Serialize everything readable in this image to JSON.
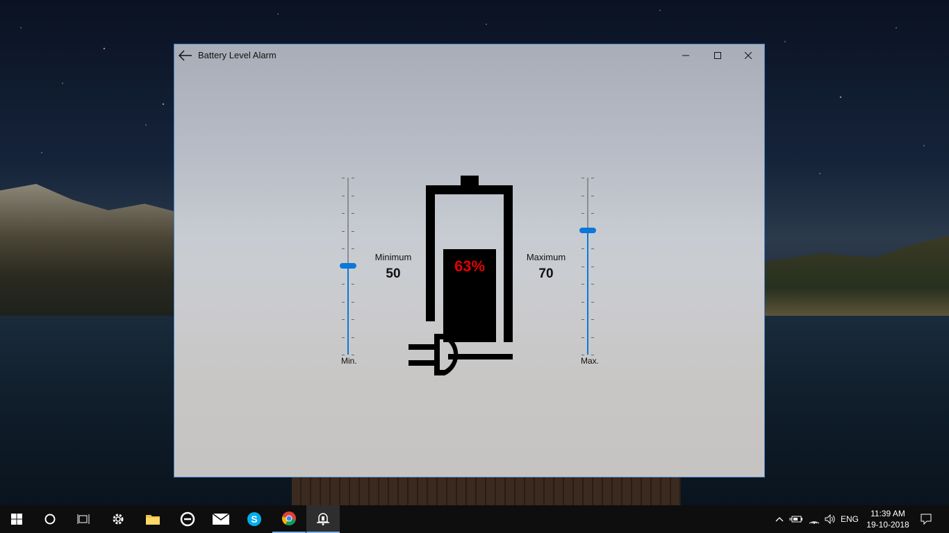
{
  "window": {
    "title": "Battery Level Alarm"
  },
  "battery": {
    "percent_text": "63%",
    "level": 0.63
  },
  "min_slider": {
    "title": "Minimum",
    "value": "50",
    "end_label": "Min.",
    "level": 0.5
  },
  "max_slider": {
    "title": "Maximum",
    "value": "70",
    "end_label": "Max.",
    "level": 0.7
  },
  "taskbar": {
    "language": "ENG",
    "time": "11:39 AM",
    "date": "19-10-2018"
  },
  "colors": {
    "accent": "#0a78d7",
    "percent_red": "#e00000",
    "window_border": "#4a86c8"
  }
}
